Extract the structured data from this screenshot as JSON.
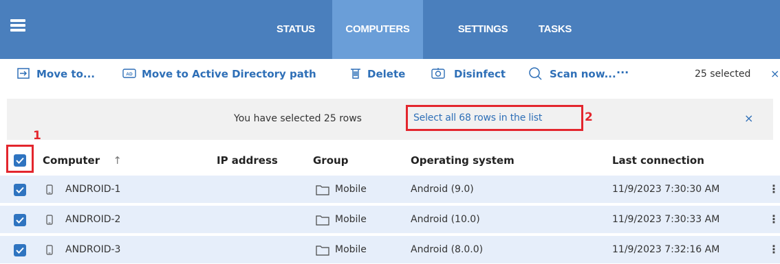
{
  "nav": {
    "tabs": [
      {
        "label": "STATUS",
        "active": false
      },
      {
        "label": "COMPUTERS",
        "active": true
      },
      {
        "label": "SETTINGS",
        "active": false
      },
      {
        "label": "TASKS",
        "active": false
      }
    ]
  },
  "toolbar": {
    "move_to_label": "Move to...",
    "move_ad_label": "Move to Active Directory path",
    "ad_icon_text": "AD",
    "delete_label": "Delete",
    "disinfect_label": "Disinfect",
    "scan_label": "Scan now...",
    "more_label": "···",
    "selected_count": "25 selected",
    "close_label": "×"
  },
  "banner": {
    "message": "You have selected 25 rows",
    "select_all_link": "Select all 68 rows in the list",
    "close_label": "×"
  },
  "markers": {
    "marker_1": "1",
    "marker_2": "2"
  },
  "table": {
    "columns": [
      "Computer",
      "IP address",
      "Group",
      "Operating system",
      "Last connection"
    ],
    "sort_indicator": "↑",
    "rows": [
      {
        "computer": "ANDROID-1",
        "ip": "",
        "group": "Mobile",
        "os": "Android (9.0)",
        "last_connection": "11/9/2023 7:30:30 AM"
      },
      {
        "computer": "ANDROID-2",
        "ip": "",
        "group": "Mobile",
        "os": "Android (10.0)",
        "last_connection": "11/9/2023 7:30:33 AM"
      },
      {
        "computer": "ANDROID-3",
        "ip": "",
        "group": "Mobile",
        "os": "Android (8.0.0)",
        "last_connection": "11/9/2023 7:32:16 AM"
      }
    ],
    "row_menu_label": "⋮"
  },
  "colors": {
    "nav_bg": "#4a7fbd",
    "nav_active": "#6a9ed8",
    "accent": "#2e6fb7",
    "highlight": "#e3262d",
    "row_bg": "#e6eefa"
  }
}
